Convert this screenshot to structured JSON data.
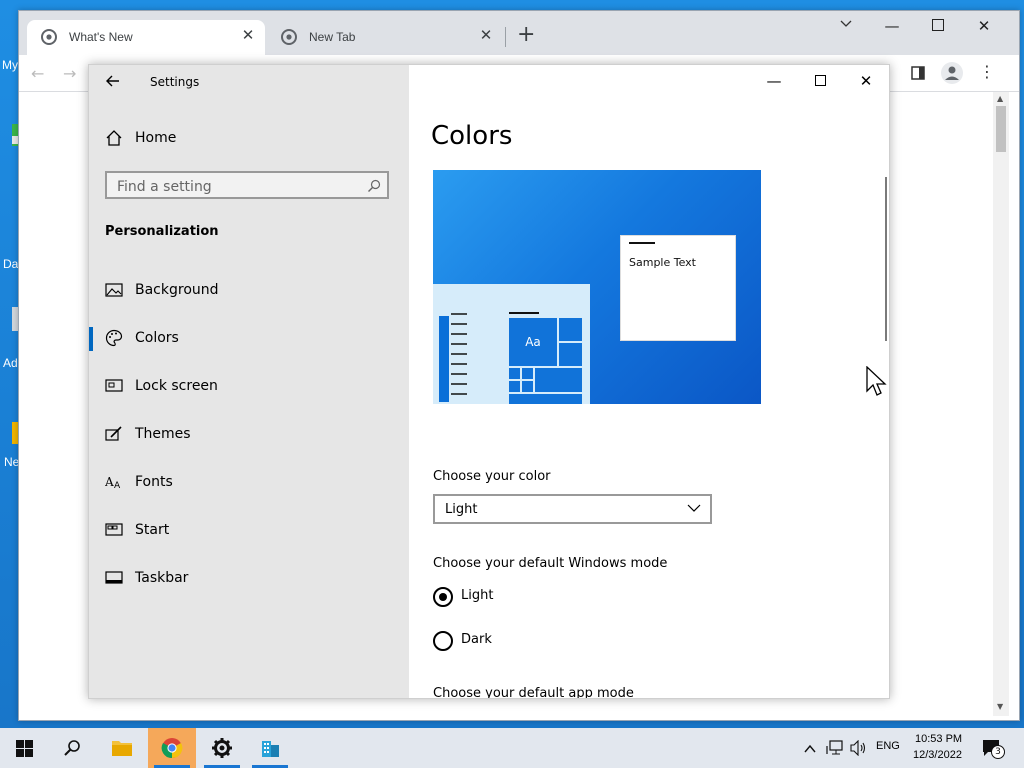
{
  "desktop": {
    "labels": [
      "My",
      "Da",
      "Ad",
      "Ne"
    ]
  },
  "chrome": {
    "tabs": [
      {
        "label": "What's New",
        "active": true
      },
      {
        "label": "New Tab",
        "active": false
      }
    ],
    "new_tab_symbol": "+"
  },
  "settings": {
    "window_title": "Settings",
    "home_label": "Home",
    "search_placeholder": "Find a setting",
    "section_label": "Personalization",
    "nav_items": [
      {
        "label": "Background",
        "icon": "image-icon"
      },
      {
        "label": "Colors",
        "icon": "palette-icon",
        "selected": true
      },
      {
        "label": "Lock screen",
        "icon": "lock-screen-icon"
      },
      {
        "label": "Themes",
        "icon": "themes-icon"
      },
      {
        "label": "Fonts",
        "icon": "fonts-icon"
      },
      {
        "label": "Start",
        "icon": "start-icon"
      },
      {
        "label": "Taskbar",
        "icon": "taskbar-icon"
      }
    ],
    "page_title": "Colors",
    "preview": {
      "sample_text": "Sample Text",
      "tile_label": "Aa"
    },
    "choose_color_label": "Choose your color",
    "choose_color_value": "Light",
    "windows_mode_label": "Choose your default Windows mode",
    "windows_mode_options": [
      {
        "label": "Light",
        "checked": true
      },
      {
        "label": "Dark",
        "checked": false
      }
    ],
    "app_mode_label": "Choose your default app mode"
  },
  "taskbar": {
    "language": "ENG",
    "time": "10:53 PM",
    "date": "12/3/2022",
    "notification_count": "3"
  },
  "colors": {
    "accent": "#0067c0",
    "desktop": "#1a86d8"
  }
}
